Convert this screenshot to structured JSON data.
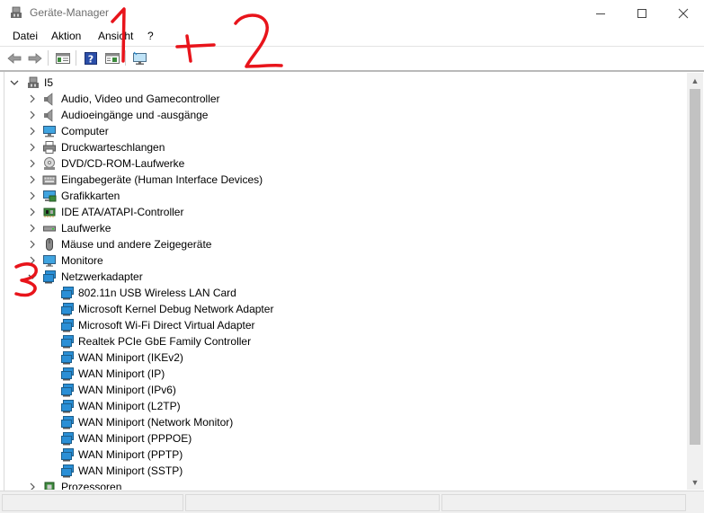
{
  "window": {
    "title": "Geräte-Manager"
  },
  "menu": {
    "datei": "Datei",
    "aktion": "Aktion",
    "ansicht": "Ansicht",
    "help": "?"
  },
  "toolbar": {
    "icons": [
      "back-arrow-icon",
      "forward-arrow-icon",
      "properties-icon",
      "help-icon",
      "view-icon",
      "monitor-scan-icon"
    ]
  },
  "tree": {
    "root": "I5",
    "categories": [
      {
        "label": "Audio, Video und Gamecontroller",
        "icon": "speaker-icon"
      },
      {
        "label": "Audioeingänge und -ausgänge",
        "icon": "speaker-icon"
      },
      {
        "label": "Computer",
        "icon": "computer-icon"
      },
      {
        "label": "Druckwarteschlangen",
        "icon": "printer-icon"
      },
      {
        "label": "DVD/CD-ROM-Laufwerke",
        "icon": "disc-drive-icon"
      },
      {
        "label": "Eingabegeräte (Human Interface Devices)",
        "icon": "keyboard-icon"
      },
      {
        "label": "Grafikkarten",
        "icon": "display-adapter-icon"
      },
      {
        "label": "IDE ATA/ATAPI-Controller",
        "icon": "controller-icon"
      },
      {
        "label": "Laufwerke",
        "icon": "drive-icon"
      },
      {
        "label": "Mäuse und andere Zeigegeräte",
        "icon": "mouse-icon"
      },
      {
        "label": "Monitore",
        "icon": "monitor-icon"
      },
      {
        "label": "Netzwerkadapter",
        "icon": "network-adapter-icon"
      }
    ],
    "network_adapters": [
      "802.11n USB Wireless LAN Card",
      "Microsoft Kernel Debug Network Adapter",
      "Microsoft Wi-Fi Direct Virtual Adapter",
      "Realtek PCIe GbE Family Controller",
      "WAN Miniport (IKEv2)",
      "WAN Miniport (IP)",
      "WAN Miniport (IPv6)",
      "WAN Miniport (L2TP)",
      "WAN Miniport (Network Monitor)",
      "WAN Miniport (PPPOE)",
      "WAN Miniport (PPTP)",
      "WAN Miniport (SSTP)"
    ],
    "after": {
      "label": "Prozessoren",
      "icon": "processor-icon"
    }
  },
  "annotations": {
    "one": "1",
    "plus": "+",
    "two": "2",
    "three": "3",
    "color": "#e8141b"
  },
  "colors": {
    "network_icon": "#2a8fd6",
    "selection_accent": "#0078d7"
  }
}
